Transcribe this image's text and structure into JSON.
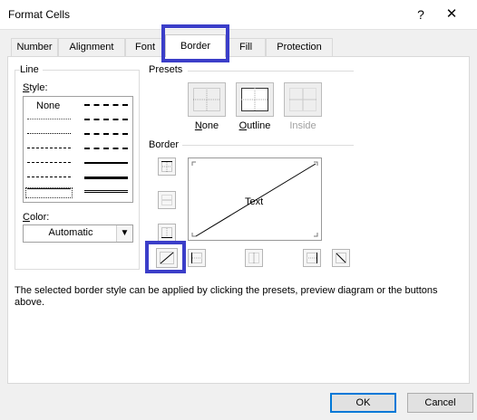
{
  "window": {
    "title": "Format Cells",
    "help_label": "?",
    "close_label": "✕"
  },
  "tabs": [
    {
      "label": "Number"
    },
    {
      "label": "Alignment"
    },
    {
      "label": "Font"
    },
    {
      "label": "Border"
    },
    {
      "label": "Fill"
    },
    {
      "label": "Protection"
    }
  ],
  "active_tab": "Border",
  "line": {
    "group_label": "Line",
    "style_label": "Style:",
    "none_label": "None",
    "color_label": "Color:",
    "color_value": "Automatic"
  },
  "presets": {
    "group_label": "Presets",
    "items": [
      {
        "label": "None",
        "enabled": true
      },
      {
        "label": "Outline",
        "enabled": true
      },
      {
        "label": "Inside",
        "enabled": false
      }
    ]
  },
  "border": {
    "group_label": "Border",
    "preview_text": "Text",
    "selected_button": "diagonal-up"
  },
  "hint_text": "The selected border style can be applied by clicking the presets, preview diagram or the buttons above.",
  "buttons": {
    "ok": "OK",
    "cancel": "Cancel"
  },
  "colors": {
    "highlight": "#3b3ec9",
    "ok_border": "#0078d7"
  }
}
